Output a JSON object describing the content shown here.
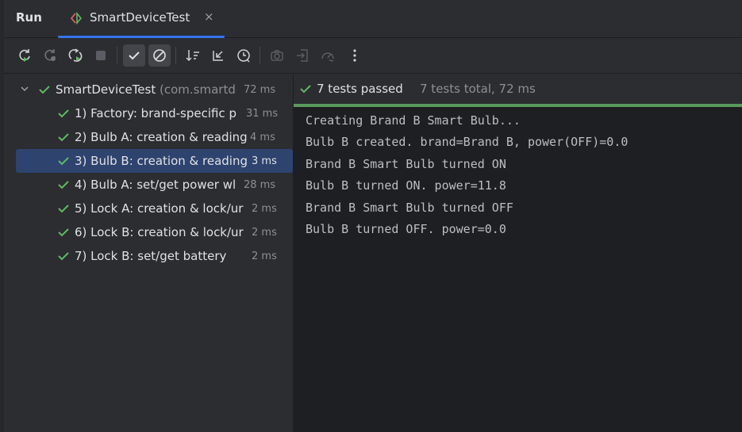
{
  "window": {
    "title": "Run",
    "tab": {
      "label": "SmartDeviceTest",
      "close": "×",
      "icon": "test-run-icon"
    }
  },
  "toolbar": {
    "buttons": [
      {
        "name": "rerun-icon",
        "active": false
      },
      {
        "name": "rerun-failed-icon",
        "active": false
      },
      {
        "name": "toggle-autotest-icon",
        "active": false
      },
      {
        "name": "stop-icon",
        "active": false
      },
      {
        "name": "show-passed-icon",
        "active": true
      },
      {
        "name": "show-ignored-icon",
        "active": true
      },
      {
        "name": "sort-alpha-icon",
        "active": false
      },
      {
        "name": "collapse-all-icon",
        "active": false
      },
      {
        "name": "sort-duration-icon",
        "active": false
      },
      {
        "name": "camera-icon",
        "active": false
      },
      {
        "name": "import-tests-icon",
        "active": false
      },
      {
        "name": "gauge-icon",
        "active": false
      },
      {
        "name": "more-icon",
        "active": false
      }
    ]
  },
  "tree": {
    "root": {
      "label": "SmartDeviceTest",
      "package": "(com.smartd",
      "time": "72 ms"
    },
    "items": [
      {
        "label": "1) Factory: brand-specific p",
        "time": "31 ms"
      },
      {
        "label": "2) Bulb A: creation & reading",
        "time": "4 ms"
      },
      {
        "label": "3) Bulb B: creation & reading",
        "time": "3 ms"
      },
      {
        "label": "4) Bulb A: set/get power wl",
        "time": "28 ms"
      },
      {
        "label": "5) Lock A: creation & lock/ur",
        "time": "2 ms"
      },
      {
        "label": "6) Lock B: creation & lock/ur",
        "time": "2 ms"
      },
      {
        "label": "7) Lock B: set/get battery",
        "time": "2 ms"
      }
    ]
  },
  "console": {
    "status": "7 tests passed",
    "summary": "7 tests total, 72 ms",
    "lines": [
      "Creating Brand B Smart Bulb...",
      "Bulb B created. brand=Brand B, power(OFF)=0.0",
      "Brand B Smart Bulb turned ON",
      "Bulb B turned ON. power=11.8",
      "Brand B Smart Bulb turned OFF",
      "Bulb B turned OFF. power=0.0"
    ]
  },
  "colors": {
    "accent": "#3574f0",
    "pass": "#5fb865",
    "selection": "#2e436e",
    "console_bg": "#1e1f22"
  }
}
